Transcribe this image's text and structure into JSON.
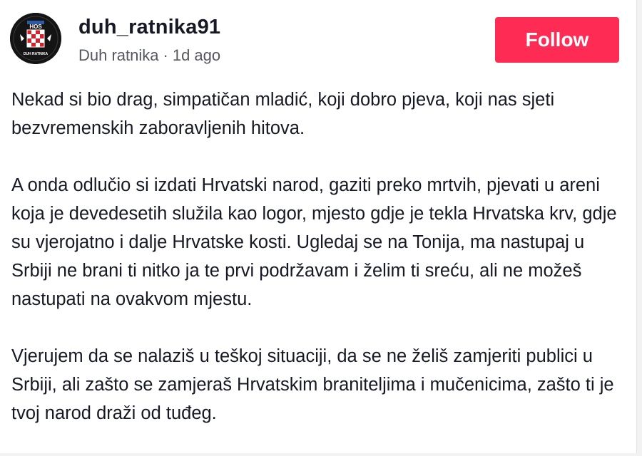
{
  "post": {
    "username": "duh_ratnika91",
    "display_name": "Duh ratnika",
    "separator": "·",
    "time_ago": "1d ago",
    "follow_label": "Follow",
    "avatar": {
      "icon": "hos-emblem-icon",
      "badge_text": "HOS",
      "ring_text": "DUH RATNIKA",
      "colors": {
        "background": "#141414",
        "red": "#d2232a",
        "white": "#ffffff"
      }
    },
    "paragraphs": [
      "Nekad si bio drag, simpatičan mladić, koji dobro pjeva, koji nas sjeti bezvremenskih zaboravljenih hitova.",
      "A onda odlučio si izdati Hrvatski narod, gaziti preko mrtvih, pjevati u areni koja je devedesetih služila kao logor, mjesto gdje je tekla Hrvatska krv, gdje su vjerojatno i dalje Hrvatske kosti. Ugledaj se na Tonija, ma nastupaj u Srbiji ne brani ti nitko ja te prvi podržavam i želim ti sreću, ali ne možeš nastupati na ovakvom mjestu.",
      "Vjerujem da se nalaziš u teškoj situaciji, da se ne želiš zamjeriti publici u Srbiji, ali zašto se zamjeraš Hrvatskim braniteljima i mučenicima, zašto ti je tvoj narod draži od tuđeg."
    ]
  },
  "colors": {
    "accent": "#fe2c55",
    "text": "#161823",
    "muted": "#555761"
  }
}
